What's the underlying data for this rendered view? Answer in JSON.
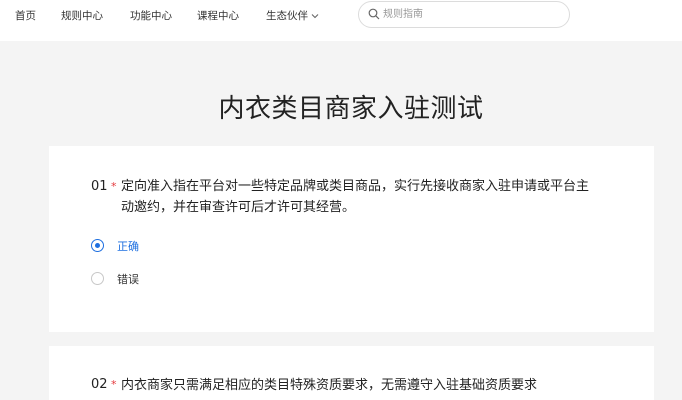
{
  "nav": {
    "items": [
      "首页",
      "规则中心",
      "功能中心",
      "课程中心",
      "生态伙伴"
    ]
  },
  "search": {
    "placeholder": "规则指南",
    "value": ""
  },
  "page": {
    "title": "内衣类目商家入驻测试"
  },
  "questions": [
    {
      "number": "01",
      "required_mark": "*",
      "text": "定向准入指在平台对一些特定品牌或类目商品，实行先接收商家入驻申请或平台主动邀约，并在审查许可后才许可其经营。",
      "options": [
        {
          "label": "正确",
          "selected": true
        },
        {
          "label": "错误",
          "selected": false
        }
      ]
    },
    {
      "number": "02",
      "required_mark": "*",
      "text": "内衣商家只需满足相应的类目特殊资质要求，无需遵守入驻基础资质要求"
    }
  ],
  "colors": {
    "accent": "#1e6fe0",
    "required": "#e4393c",
    "background": "#f4f4f4"
  },
  "icons": {
    "search": "magnifier-icon",
    "dropdown": "chevron-down-icon"
  }
}
